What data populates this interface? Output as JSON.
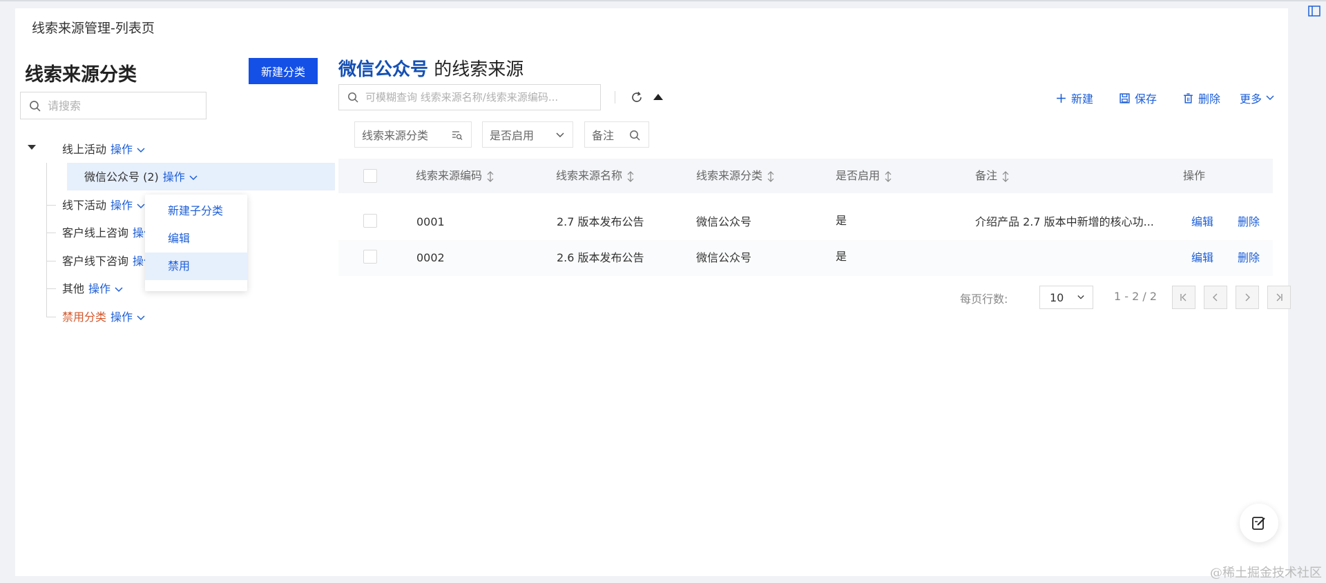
{
  "page": {
    "title": "线索来源管理-列表页"
  },
  "left": {
    "heading": "线索来源分类",
    "new_button": "新建分类",
    "search_placeholder": "请搜索",
    "tree": [
      {
        "label": "线上活动",
        "op": "操作"
      },
      {
        "label": "微信公众号 (2)",
        "op": "操作"
      },
      {
        "label": "线下活动",
        "op": "操作"
      },
      {
        "label": "客户线上咨询",
        "op": "操作"
      },
      {
        "label": "客户线下咨询",
        "op": "操作"
      },
      {
        "label": "其他",
        "op": "操作"
      },
      {
        "label": "禁用分类",
        "op": "操作"
      }
    ],
    "dropdown": [
      "新建子分类",
      "编辑",
      "禁用"
    ]
  },
  "main": {
    "heading_highlight": "微信公众号",
    "heading_rest": " 的线索来源",
    "search_placeholder": "可模糊查询 线索来源名称/线索来源编码...",
    "toolbar": {
      "new": "新建",
      "save": "保存",
      "delete": "删除",
      "more": "更多"
    },
    "filters": [
      "线索来源分类",
      "是否启用",
      "备注"
    ],
    "columns": [
      "线索来源编码",
      "线索来源名称",
      "线索来源分类",
      "是否启用",
      "备注",
      "操作"
    ],
    "rows": [
      {
        "code": "0001",
        "name": "2.7 版本发布公告",
        "category": "微信公众号",
        "enabled": "是",
        "remark": "介绍产品 2.7 版本中新增的核心功...",
        "edit": "编辑",
        "delete": "删除"
      },
      {
        "code": "0002",
        "name": "2.6 版本发布公告",
        "category": "微信公众号",
        "enabled": "是",
        "remark": "",
        "edit": "编辑",
        "delete": "删除"
      }
    ],
    "pagination": {
      "label": "每页行数:",
      "page_size": "10",
      "range": "1 - 2 / 2"
    }
  },
  "watermark": "@稀土掘金技术社区",
  "colors": {
    "primary": "#1450e6",
    "link": "#1d5fd8",
    "selected_bg": "#e6effc",
    "disabled_text": "#d4572a"
  }
}
